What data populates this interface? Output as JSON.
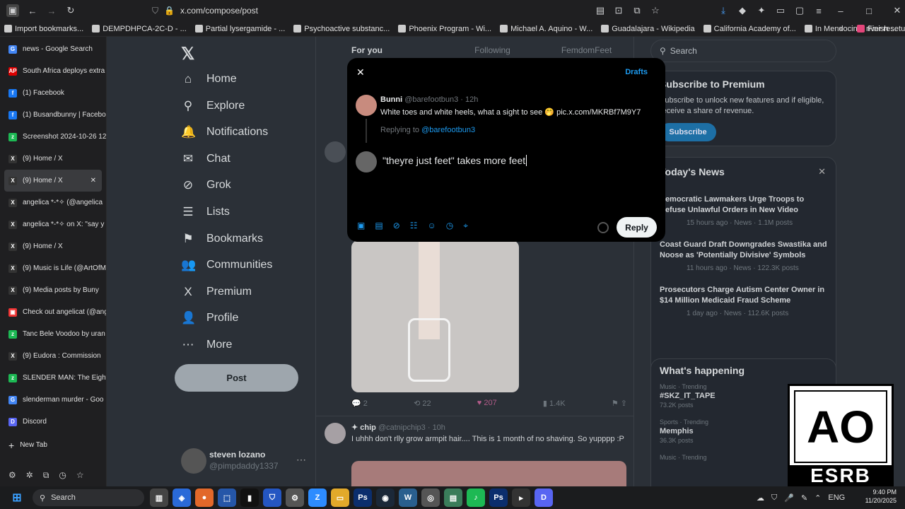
{
  "browser": {
    "url": "x.com/compose/post",
    "bookmarks": [
      "Import bookmarks...",
      "DEMPDHPCA-2C-D - ...",
      "Partial lysergamide - ...",
      "Psychoactive substanc...",
      "Phoenix Program - Wi...",
      "Michael A. Aquino - W...",
      "Guadalajara - Wikipedia",
      "California Academy of...",
      "In Mendocino, river re..."
    ],
    "finish_setup": "Finish setup"
  },
  "tabs": [
    {
      "label": "news - Google Search",
      "icon": "G",
      "color": "#4285f4"
    },
    {
      "label": "South Africa deploys extra",
      "icon": "AP",
      "color": "#d00"
    },
    {
      "label": "(1) Facebook",
      "icon": "f",
      "color": "#1877f2"
    },
    {
      "label": "(1) Busandbunny | Faceboo",
      "icon": "f",
      "color": "#1877f2"
    },
    {
      "label": "Screenshot 2024-10-26 12",
      "icon": "z",
      "color": "#1db954"
    },
    {
      "label": "(9) Home / X",
      "icon": "X",
      "color": "#333"
    },
    {
      "label": "(9) Home / X",
      "icon": "X",
      "color": "#333",
      "active": true
    },
    {
      "label": "angelica *-*✧ (@angelica",
      "icon": "X",
      "color": "#333"
    },
    {
      "label": "angelica *-*✧ on X: \"say y",
      "icon": "X",
      "color": "#333"
    },
    {
      "label": "(9) Home / X",
      "icon": "X",
      "color": "#333"
    },
    {
      "label": "(9) Music is Life (@ArtOfM",
      "icon": "X",
      "color": "#333"
    },
    {
      "label": "(9) Media posts by Buny",
      "icon": "X",
      "color": "#333"
    },
    {
      "label": "Check out angelicat (@ang",
      "icon": "▣",
      "color": "#e33"
    },
    {
      "label": "Tanc Bele Voodoo by uran",
      "icon": "z",
      "color": "#1db954"
    },
    {
      "label": "(9) Eudora : Commission",
      "icon": "X",
      "color": "#333"
    },
    {
      "label": "SLENDER MAN: The Eight",
      "icon": "z",
      "color": "#1db954"
    },
    {
      "label": "slenderman murder - Goo",
      "icon": "G",
      "color": "#4285f4"
    },
    {
      "label": "Discord",
      "icon": "D",
      "color": "#5865f2"
    }
  ],
  "new_tab": "New Tab",
  "x_nav": [
    {
      "label": "Home",
      "icon": "⌂"
    },
    {
      "label": "Explore",
      "icon": "⚲"
    },
    {
      "label": "Notifications",
      "icon": "🔔"
    },
    {
      "label": "Chat",
      "icon": "✉"
    },
    {
      "label": "Grok",
      "icon": "⊘"
    },
    {
      "label": "Lists",
      "icon": "☰"
    },
    {
      "label": "Bookmarks",
      "icon": "⚑"
    },
    {
      "label": "Communities",
      "icon": "👥"
    },
    {
      "label": "Premium",
      "icon": "X"
    },
    {
      "label": "Profile",
      "icon": "👤"
    },
    {
      "label": "More",
      "icon": "⋯"
    }
  ],
  "post_button": "Post",
  "account": {
    "name": "steven lozano",
    "handle": "@pimpdaddy1337"
  },
  "feed_tabs": [
    "For you",
    "Following",
    "FemdomFeet"
  ],
  "feed_post_stats": {
    "replies": "2",
    "reposts": "22",
    "likes": "207",
    "views": "1.4K"
  },
  "next_post": {
    "name": "✦ chip",
    "handle": "@catnipchip3",
    "time": "10h",
    "text": "I uhhh don't rlly grow armpit hair.... This is 1 month of no shaving. So yupppp :P"
  },
  "search_placeholder": "Search",
  "premium": {
    "title": "Subscribe to Premium",
    "text": "Subscribe to unlock new features and if eligible, receive a share of revenue.",
    "button": "Subscribe"
  },
  "news": {
    "title": "Today's News",
    "items": [
      {
        "headline": "Democratic Lawmakers Urge Troops to Refuse Unlawful Orders in New Video",
        "meta": "15 hours ago · News · 1.1M posts"
      },
      {
        "headline": "Coast Guard Draft Downgrades Swastika and Noose as 'Potentially Divisive' Symbols",
        "meta": "11 hours ago · News · 122.3K posts"
      },
      {
        "headline": "Prosecutors Charge Autism Center Owner in $14 Million Medicaid Fraud Scheme",
        "meta": "1 day ago · News · 112.6K posts"
      }
    ]
  },
  "happening": {
    "title": "What's happening",
    "items": [
      {
        "context": "Music · Trending",
        "tag": "#SKZ_IT_TAPE",
        "posts": "73.2K posts"
      },
      {
        "context": "Sports · Trending",
        "tag": "Memphis",
        "posts": "36.3K posts"
      },
      {
        "context": "Music · Trending",
        "tag": "",
        "posts": ""
      }
    ]
  },
  "modal": {
    "drafts": "Drafts",
    "orig_name": "Bunni",
    "orig_handle": "@barefootbun3 · 12h",
    "orig_text": "White toes and white heels, what a sight to see 🤭 pic.x.com/MKRBf7M9Y7",
    "replying_prefix": "Replying to ",
    "replying_handle": "@barefootbun3",
    "reply_text": "\"theyre just feet\" takes more feet",
    "reply_button": "Reply"
  },
  "esrb": {
    "text": "ESRB",
    "rating": "AO"
  },
  "taskbar": {
    "search": "Search",
    "lang": "ENG",
    "time": "9:40 PM",
    "date": "11/20/2025"
  }
}
